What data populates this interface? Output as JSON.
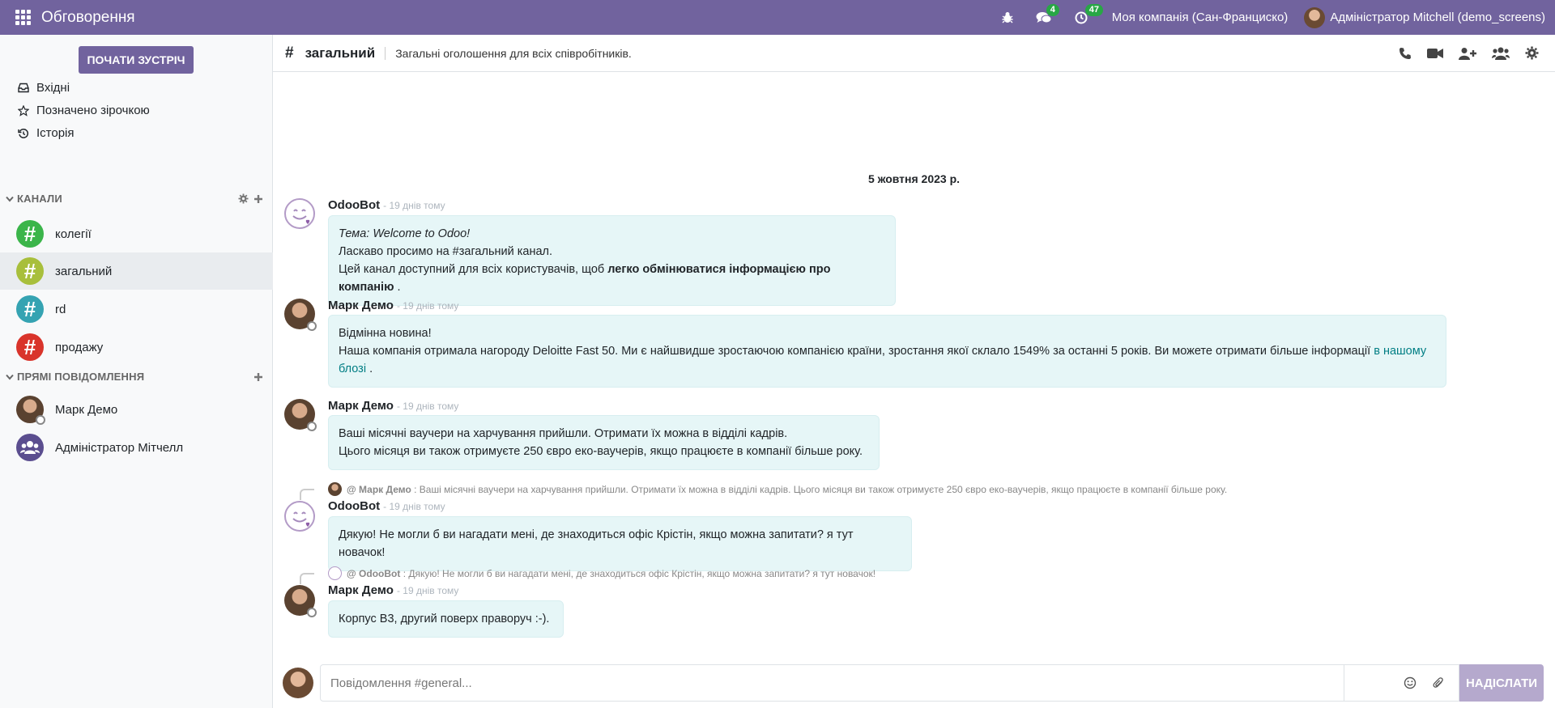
{
  "navbar": {
    "app_title": "Обговорення",
    "messages_badge": "4",
    "activities_badge": "47",
    "company": "Моя компанія (Сан-Франциско)",
    "user": "Адміністратор Mitchell (demo_screens)"
  },
  "sidebar": {
    "meeting_button": "ПОЧАТИ ЗУСТРІЧ",
    "mailboxes": [
      {
        "label": "Вхідні",
        "icon": "inbox-icon"
      },
      {
        "label": "Позначено зірочкою",
        "icon": "star-icon"
      },
      {
        "label": "Історія",
        "icon": "history-icon"
      }
    ],
    "channels_header": "КАНАЛИ",
    "channels": [
      {
        "label": "колегії",
        "color": "#3bb54a"
      },
      {
        "label": "загальний",
        "color": "#a8bf3c"
      },
      {
        "label": "rd",
        "color": "#35a3b2"
      },
      {
        "label": "продажу",
        "color": "#d9342b"
      }
    ],
    "dm_header": "ПРЯМІ ПОВІДОМЛЕННЯ",
    "direct_messages": [
      {
        "label": "Марк Демо"
      },
      {
        "label": "Адміністратор Мітчелл"
      }
    ]
  },
  "thread": {
    "hash": "#",
    "name": "загальний",
    "description": "Загальні оголошення для всіх співробітників."
  },
  "messages": {
    "date_separator": "5 жовтня 2023 р.",
    "items": [
      {
        "author": "OdooBot",
        "date": "- 19 днів тому",
        "line1_label": "Тема:",
        "line1_text": "Welcome to Odoo!",
        "line2": "Ласкаво просимо на #загальний канал.",
        "line3_prefix": "Цей канал доступний для всіх користувачів, щоб",
        "line3_bold": "легко обмінюватися інформацією про компанію",
        "line3_suffix": "."
      },
      {
        "author": "Марк Демо",
        "date": "- 19 днів тому",
        "line1": "Відмінна новина!",
        "line2": "Наша компанія отримала нагороду Deloitte Fast 50. Ми є найшвидше зростаючою компанією країни, зростання якої склало 1549% за останні 5 років. Ви можете отримати більше інформації",
        "link": "в нашому блозі",
        "suffix": "."
      },
      {
        "author": "Марк Демо",
        "date": "- 19 днів тому",
        "line1": "Ваші місячні ваучери на харчування прийшли. Отримати їх можна в відділі кадрів.",
        "line2": "Цього місяця ви також отримуєте 250 євро еко-ваучерів, якщо працюєте в компанії більше року."
      },
      {
        "reply_author": "@ Марк Демо",
        "reply_text": ": Ваші місячні ваучери на харчування прийшли. Отримати їх можна в відділі кадрів. Цього місяця ви також отримуєте 250 євро еко-ваучерів, якщо працюєте в компанії більше року.",
        "author": "OdooBot",
        "date": "- 19 днів тому",
        "line1": "Дякую! Не могли б ви нагадати мені, де знаходиться офіс Крістін, якщо можна запитати? я тут новачок!"
      },
      {
        "reply_author": "@ OdooBot",
        "reply_text": ": Дякую! Не могли б ви нагадати мені, де знаходиться офіс Крістін, якщо можна запитати? я тут новачок!",
        "author": "Марк Демо",
        "date": "- 19 днів тому",
        "line1": "Корпус B3, другий поверх праворуч :-)."
      }
    ]
  },
  "composer": {
    "placeholder": "Повідомлення #general...",
    "send_label": "НАДІСЛАТИ"
  },
  "colors": {
    "brand": "#71639e",
    "bubble": "#e6f6f7",
    "badge": "#28a745"
  }
}
